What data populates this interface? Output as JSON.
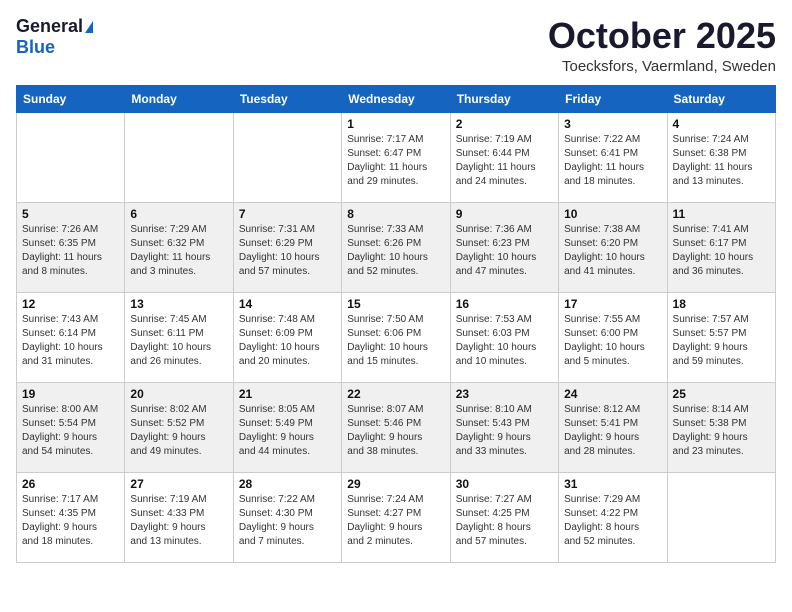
{
  "header": {
    "logo_general": "General",
    "logo_blue": "Blue",
    "month_title": "October 2025",
    "location": "Toecksfors, Vaermland, Sweden"
  },
  "weekdays": [
    "Sunday",
    "Monday",
    "Tuesday",
    "Wednesday",
    "Thursday",
    "Friday",
    "Saturday"
  ],
  "weeks": [
    [
      {
        "day": "",
        "info": ""
      },
      {
        "day": "",
        "info": ""
      },
      {
        "day": "",
        "info": ""
      },
      {
        "day": "1",
        "info": "Sunrise: 7:17 AM\nSunset: 6:47 PM\nDaylight: 11 hours\nand 29 minutes."
      },
      {
        "day": "2",
        "info": "Sunrise: 7:19 AM\nSunset: 6:44 PM\nDaylight: 11 hours\nand 24 minutes."
      },
      {
        "day": "3",
        "info": "Sunrise: 7:22 AM\nSunset: 6:41 PM\nDaylight: 11 hours\nand 18 minutes."
      },
      {
        "day": "4",
        "info": "Sunrise: 7:24 AM\nSunset: 6:38 PM\nDaylight: 11 hours\nand 13 minutes."
      }
    ],
    [
      {
        "day": "5",
        "info": "Sunrise: 7:26 AM\nSunset: 6:35 PM\nDaylight: 11 hours\nand 8 minutes."
      },
      {
        "day": "6",
        "info": "Sunrise: 7:29 AM\nSunset: 6:32 PM\nDaylight: 11 hours\nand 3 minutes."
      },
      {
        "day": "7",
        "info": "Sunrise: 7:31 AM\nSunset: 6:29 PM\nDaylight: 10 hours\nand 57 minutes."
      },
      {
        "day": "8",
        "info": "Sunrise: 7:33 AM\nSunset: 6:26 PM\nDaylight: 10 hours\nand 52 minutes."
      },
      {
        "day": "9",
        "info": "Sunrise: 7:36 AM\nSunset: 6:23 PM\nDaylight: 10 hours\nand 47 minutes."
      },
      {
        "day": "10",
        "info": "Sunrise: 7:38 AM\nSunset: 6:20 PM\nDaylight: 10 hours\nand 41 minutes."
      },
      {
        "day": "11",
        "info": "Sunrise: 7:41 AM\nSunset: 6:17 PM\nDaylight: 10 hours\nand 36 minutes."
      }
    ],
    [
      {
        "day": "12",
        "info": "Sunrise: 7:43 AM\nSunset: 6:14 PM\nDaylight: 10 hours\nand 31 minutes."
      },
      {
        "day": "13",
        "info": "Sunrise: 7:45 AM\nSunset: 6:11 PM\nDaylight: 10 hours\nand 26 minutes."
      },
      {
        "day": "14",
        "info": "Sunrise: 7:48 AM\nSunset: 6:09 PM\nDaylight: 10 hours\nand 20 minutes."
      },
      {
        "day": "15",
        "info": "Sunrise: 7:50 AM\nSunset: 6:06 PM\nDaylight: 10 hours\nand 15 minutes."
      },
      {
        "day": "16",
        "info": "Sunrise: 7:53 AM\nSunset: 6:03 PM\nDaylight: 10 hours\nand 10 minutes."
      },
      {
        "day": "17",
        "info": "Sunrise: 7:55 AM\nSunset: 6:00 PM\nDaylight: 10 hours\nand 5 minutes."
      },
      {
        "day": "18",
        "info": "Sunrise: 7:57 AM\nSunset: 5:57 PM\nDaylight: 9 hours\nand 59 minutes."
      }
    ],
    [
      {
        "day": "19",
        "info": "Sunrise: 8:00 AM\nSunset: 5:54 PM\nDaylight: 9 hours\nand 54 minutes."
      },
      {
        "day": "20",
        "info": "Sunrise: 8:02 AM\nSunset: 5:52 PM\nDaylight: 9 hours\nand 49 minutes."
      },
      {
        "day": "21",
        "info": "Sunrise: 8:05 AM\nSunset: 5:49 PM\nDaylight: 9 hours\nand 44 minutes."
      },
      {
        "day": "22",
        "info": "Sunrise: 8:07 AM\nSunset: 5:46 PM\nDaylight: 9 hours\nand 38 minutes."
      },
      {
        "day": "23",
        "info": "Sunrise: 8:10 AM\nSunset: 5:43 PM\nDaylight: 9 hours\nand 33 minutes."
      },
      {
        "day": "24",
        "info": "Sunrise: 8:12 AM\nSunset: 5:41 PM\nDaylight: 9 hours\nand 28 minutes."
      },
      {
        "day": "25",
        "info": "Sunrise: 8:14 AM\nSunset: 5:38 PM\nDaylight: 9 hours\nand 23 minutes."
      }
    ],
    [
      {
        "day": "26",
        "info": "Sunrise: 7:17 AM\nSunset: 4:35 PM\nDaylight: 9 hours\nand 18 minutes."
      },
      {
        "day": "27",
        "info": "Sunrise: 7:19 AM\nSunset: 4:33 PM\nDaylight: 9 hours\nand 13 minutes."
      },
      {
        "day": "28",
        "info": "Sunrise: 7:22 AM\nSunset: 4:30 PM\nDaylight: 9 hours\nand 7 minutes."
      },
      {
        "day": "29",
        "info": "Sunrise: 7:24 AM\nSunset: 4:27 PM\nDaylight: 9 hours\nand 2 minutes."
      },
      {
        "day": "30",
        "info": "Sunrise: 7:27 AM\nSunset: 4:25 PM\nDaylight: 8 hours\nand 57 minutes."
      },
      {
        "day": "31",
        "info": "Sunrise: 7:29 AM\nSunset: 4:22 PM\nDaylight: 8 hours\nand 52 minutes."
      },
      {
        "day": "",
        "info": ""
      }
    ]
  ]
}
